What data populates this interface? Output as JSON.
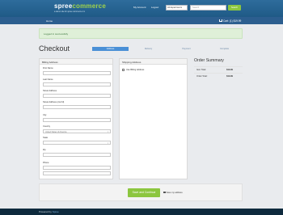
{
  "header": {
    "logo_main": "spree",
    "logo_accent": "commerce",
    "tagline": "a demo site for spree commerce 2.x",
    "my_account": "My Account",
    "logout": "Logout",
    "taxonomy_select": "All departments",
    "search_placeholder": "Search",
    "search_button": "Search"
  },
  "nav": {
    "home": "Home",
    "cart": "Cart: (1) $19.99"
  },
  "flash": {
    "message": "Logged in successfully"
  },
  "page_title": "Checkout",
  "steps": [
    {
      "label": "Address",
      "active": true
    },
    {
      "label": "Delivery",
      "active": false
    },
    {
      "label": "Payment",
      "active": false
    },
    {
      "label": "Complete",
      "active": false
    }
  ],
  "billing": {
    "heading": "Billing Address",
    "first_name": "First Name",
    "last_name": "Last Name",
    "street": "Street Address",
    "street2": "Street Address (cont'd)",
    "city": "City",
    "country_label": "Country",
    "country_value": "United States of America",
    "state_label": "State",
    "zip": "Zip",
    "phone": "Phone"
  },
  "shipping": {
    "heading": "Shipping Address",
    "use_billing": "Use Billing Address"
  },
  "summary": {
    "title": "Order Summary",
    "item_total_label": "Item Total:",
    "item_total_value": "$19.99",
    "order_total_label": "Order Total:",
    "order_total_value": "$19.99"
  },
  "actions": {
    "save_continue": "Save and Continue",
    "save_user_address": "Save my address"
  },
  "footer": {
    "powered_by": "Powered by",
    "spree_link": "Spree"
  },
  "colors": {
    "header_blue": "#2e6c9c",
    "accent_green": "#8cc63f",
    "step_active": "#4a90d6"
  }
}
